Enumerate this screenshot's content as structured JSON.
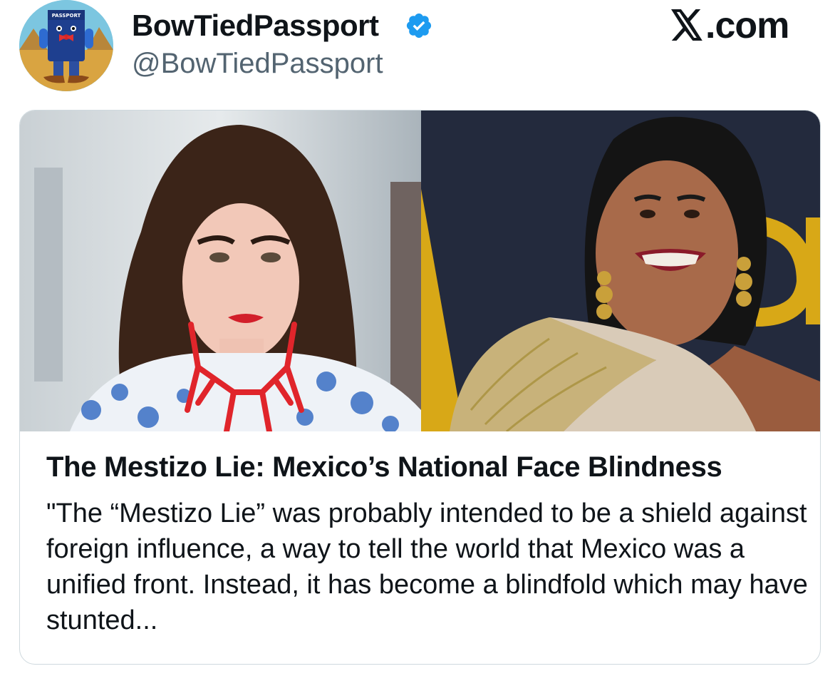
{
  "author": {
    "display_name": "BowTiedPassport",
    "handle": "@BowTiedPassport",
    "verified": true,
    "avatar_icon": "cartoon-passport-mascot-avatar"
  },
  "brand": {
    "label": ".com",
    "icon": "x-logo-icon"
  },
  "card": {
    "title": "The Mestizo Lie: Mexico’s National Face Blindness",
    "description": "\"The “Mestizo Lie” was probably intended to be a shield against foreign influence, a way to tell the world that Mexico was a unified front. Instead, it has become a blindfold which may have stunted...",
    "images": [
      {
        "icon": "portrait-photo-left"
      },
      {
        "icon": "portrait-photo-right"
      }
    ]
  },
  "colors": {
    "verified_blue": "#1d9bf0",
    "text_primary": "#0f1419",
    "text_secondary": "#536471",
    "border": "#cfd9de"
  }
}
